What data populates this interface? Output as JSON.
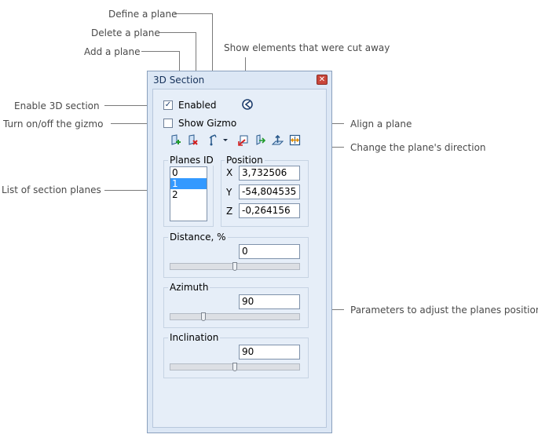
{
  "callouts": {
    "define_plane": "Define a plane",
    "delete_plane": "Delete a plane",
    "add_plane": "Add a plane",
    "show_cut_elements": "Show elements that were cut away",
    "enable_section": "Enable 3D section",
    "toggle_gizmo": "Turn on/off the gizmo",
    "align_plane": "Align a plane",
    "change_direction": "Change the plane's direction",
    "section_list": "List of section planes",
    "adjust_params": "Parameters to adjust the planes position"
  },
  "panel": {
    "title": "3D Section",
    "close_glyph": "✕",
    "enabled_label": "Enabled",
    "enabled_checked": true,
    "show_gizmo_label": "Show Gizmo",
    "show_gizmo_checked": false
  },
  "icons": {
    "show_cut": "cut-elements-icon",
    "add_plane": "add-plane-icon",
    "delete_plane": "delete-plane-icon",
    "define_plane": "define-plane-icon",
    "dropdown": "dropdown-arrow-icon",
    "align_1": "align-plane-icon",
    "align_2": "align-plane-normal-icon",
    "align_3": "align-plane-up-icon",
    "direction": "flip-direction-icon"
  },
  "planes": {
    "header": "Planes ID",
    "items": [
      "0",
      "1",
      "2"
    ],
    "selected_index": 1
  },
  "position": {
    "header": "Position",
    "x_label": "X",
    "x": "3,732506",
    "y_label": "Y",
    "y": "-54,804535",
    "z_label": "Z",
    "z": "-0,264156"
  },
  "distance": {
    "label": "Distance, %",
    "value": "0",
    "slider_fraction": 0.5
  },
  "azimuth": {
    "label": "Azimuth",
    "value": "90",
    "slider_fraction": 0.25
  },
  "inclination": {
    "label": "Inclination",
    "value": "90",
    "slider_fraction": 0.5
  }
}
